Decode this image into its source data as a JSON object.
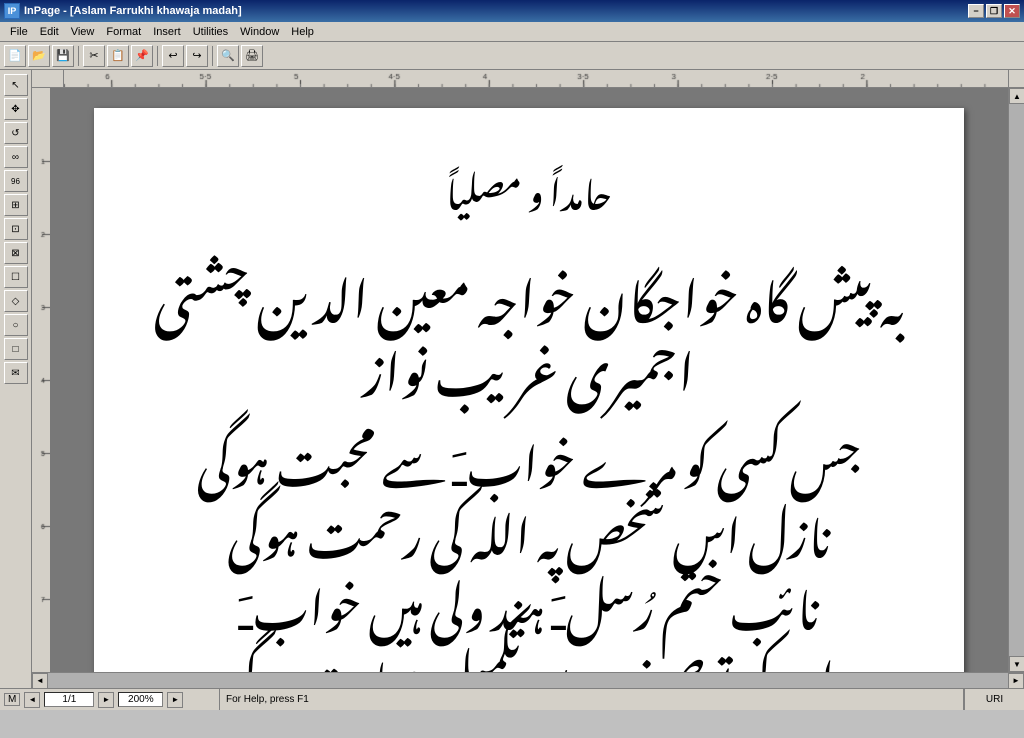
{
  "titlebar": {
    "app_name": "InPage",
    "doc_name": "[Aslam Farrukhi khawaja madah]",
    "full_title": "InPage - [Aslam Farrukhi khawaja madah]",
    "icon_text": "IP",
    "btn_minimize": "−",
    "btn_restore": "❒",
    "btn_close": "✕"
  },
  "menubar": {
    "items": [
      "File",
      "Edit",
      "View",
      "Format",
      "Insert",
      "Utilities",
      "Window",
      "Help"
    ]
  },
  "toolbar": {
    "buttons": []
  },
  "lefttools": {
    "tools": [
      "↖",
      "✥",
      "↺",
      "∞",
      "96",
      "⊞",
      "⊡",
      "⊠",
      "☐",
      "◇",
      "○",
      "□",
      "✉"
    ]
  },
  "content": {
    "line1": "حـــامداً و مصلیاً",
    "line2": "بہ پیش گاہ خواجگان خواجہ معین الدین چشتی اجمیری غریب نواز",
    "line3": "جس کسی کو مـــرے خوابﹷ سے محبت ہوگی",
    "line4": "نازل اس شخص پہ اللہ کی رحمت ہوگی",
    "line5": "نائـب ختم رُسلﹷ ہند ولی ہیں خوابﹷ",
    "line6": "ان کی توصیف سے تکمیل عبادت ہوگی"
  },
  "statusbar": {
    "mode": "M",
    "page_current": "1",
    "page_total": "1",
    "zoom": "200%",
    "help_text": "For Help, press F1",
    "right_label": "URI"
  },
  "ruler": {
    "top_marks": [
      "6",
      "5·5",
      "5",
      "4·5",
      "4",
      "3·5",
      "3",
      "2·5",
      "2"
    ],
    "left_marks": [
      "1",
      "2",
      "3",
      "4",
      "5",
      "6",
      "7"
    ]
  }
}
